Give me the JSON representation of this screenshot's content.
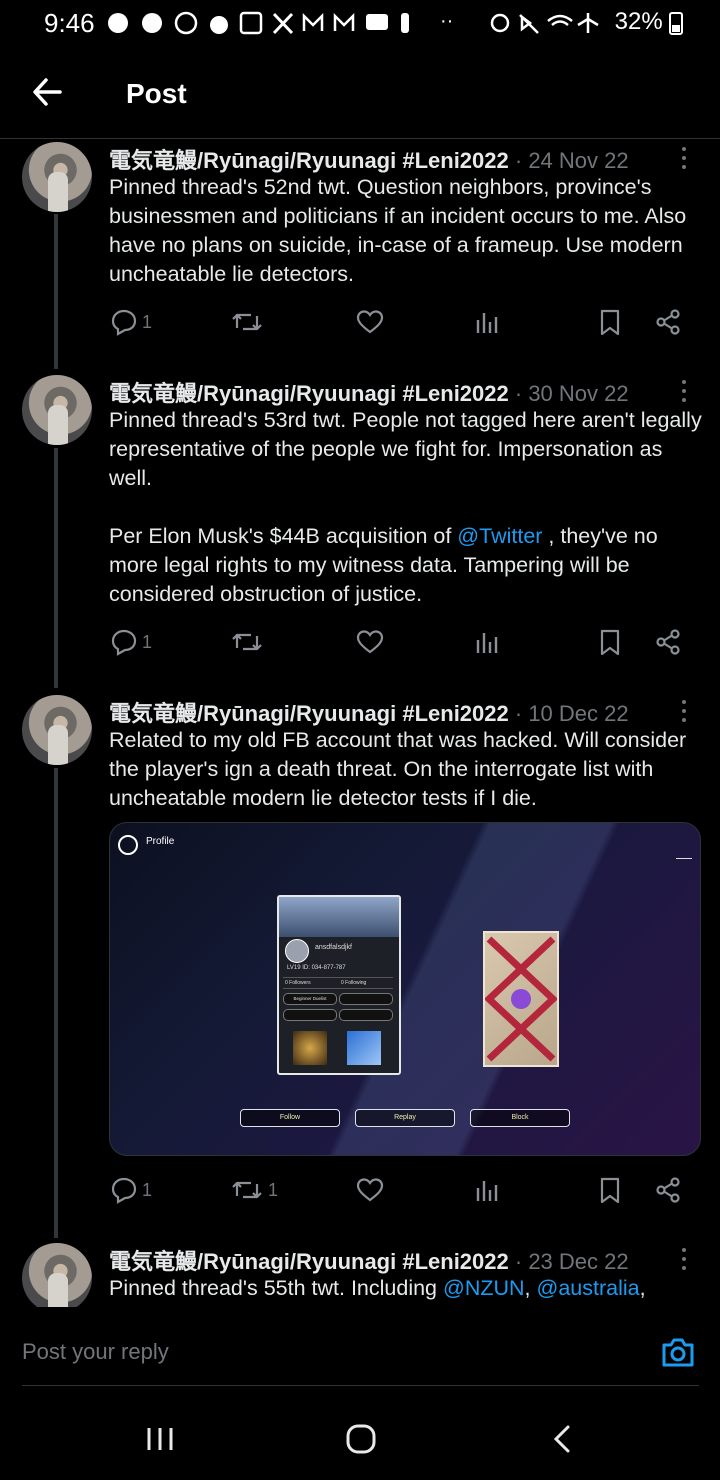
{
  "status_bar": {
    "time": "9:46",
    "icons": [
      "messenger-icon",
      "messenger-icon",
      "account-icon",
      "reddit-icon",
      "twitch-icon",
      "x-icon",
      "gmail-icon",
      "gmail-icon",
      "chat-icon",
      "notification-icon",
      "more-dots"
    ],
    "battery": "32%"
  },
  "header": {
    "title": "Post"
  },
  "posts": [
    {
      "author": "電気竜鰻/Ryūnagi/Ryuunagi #Leni2022",
      "date": "· 24 Nov 22",
      "paragraphs": [
        "Pinned thread's 52nd twt. Question neighbors, province's businessmen and politicians if an incident occurs to me. Also have no plans on suicide, in-case of a frameup. Use modern uncheatable lie detectors."
      ],
      "reply_count": "1",
      "repost_count": ""
    },
    {
      "author": "電気竜鰻/Ryūnagi/Ryuunagi #Leni2022",
      "date": "· 30 Nov 22",
      "paragraphs": [
        "Pinned thread's 53rd twt. People not tagged here aren't legally representative of the people we fight for. Impersonation as well.",
        "Per Elon Musk's $44B acquisition of ",
        "@Twitter",
        " , they've no more legal rights to my witness data. Tampering will be considered obstruction of justice."
      ],
      "reply_count": "1",
      "repost_count": ""
    },
    {
      "author": "電気竜鰻/Ryūnagi/Ryuunagi #Leni2022",
      "date": "· 10 Dec 22",
      "paragraphs": [
        "Related to my old FB account that was hacked. Will consider the player's ign a death threat. On the interrogate list with uncheatable modern lie detector tests if I die."
      ],
      "reply_count": "1",
      "repost_count": "1",
      "media": {
        "title": "Profile",
        "username": "ansdfalsdjkf",
        "level_id": "LV19    ID: 034-877-787",
        "followers": "0 Followers",
        "following": "0 Following",
        "badge": "Beginner Duelist",
        "buttons": [
          "Follow",
          "Replay",
          "Block"
        ]
      }
    },
    {
      "author": "電気竜鰻/Ryūnagi/Ryuunagi #Leni2022",
      "date": "· 23 Dec 22",
      "text_start": "Pinned thread's 55th twt. Including ",
      "mention1": "@NZUN",
      "sep": ", ",
      "mention2": "@australia",
      "text_end": ","
    }
  ],
  "reply": {
    "placeholder": "Post your reply"
  },
  "colors": {
    "background": "#000000",
    "text": "#e7e9ea",
    "muted": "#71767b",
    "link": "#1d9bf0"
  }
}
